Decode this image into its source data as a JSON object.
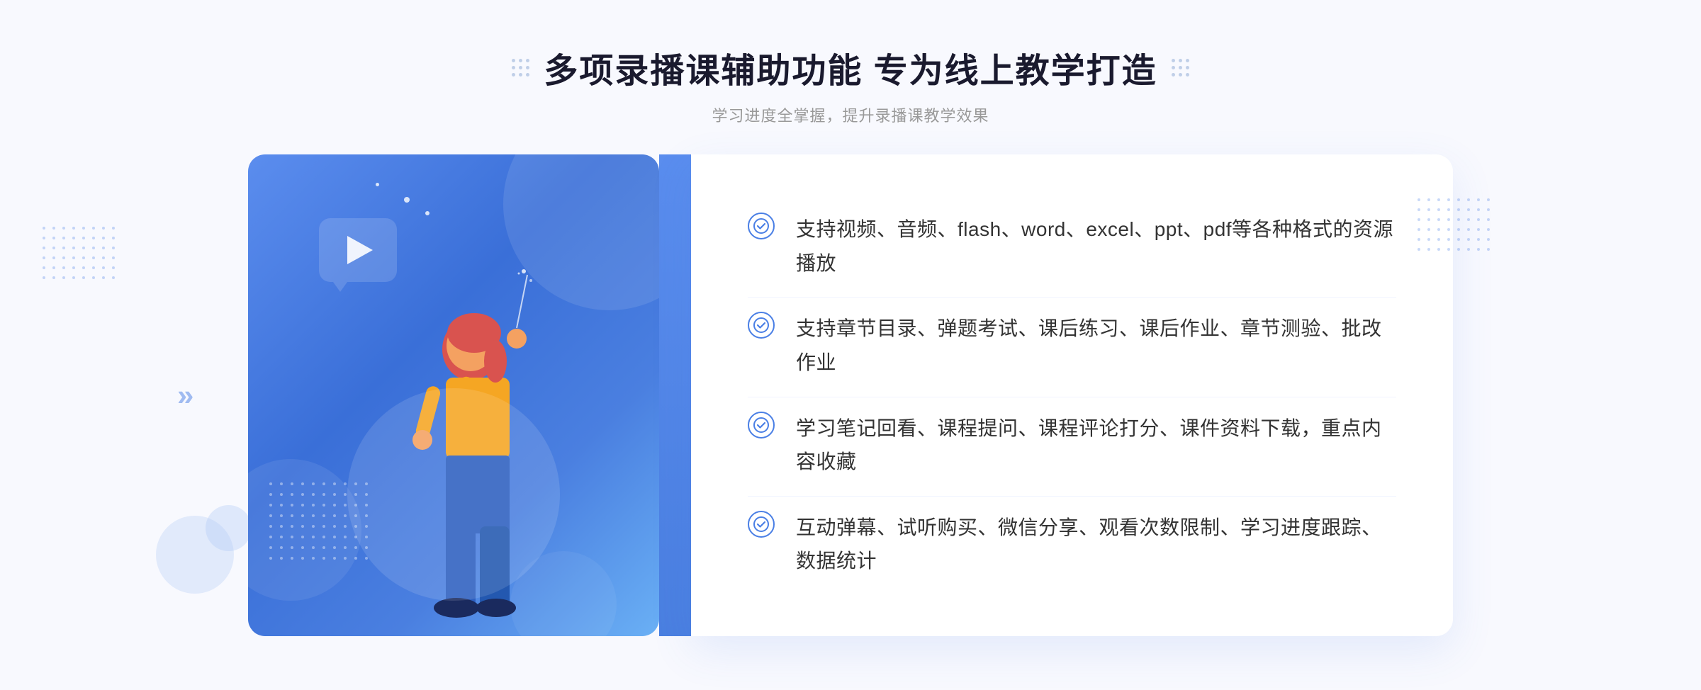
{
  "page": {
    "background_color": "#f8f9fe"
  },
  "header": {
    "title": "多项录播课辅助功能 专为线上教学打造",
    "subtitle": "学习进度全掌握，提升录播课教学效果"
  },
  "features": [
    {
      "id": "feature-1",
      "text": "支持视频、音频、flash、word、excel、ppt、pdf等各种格式的资源播放"
    },
    {
      "id": "feature-2",
      "text": "支持章节目录、弹题考试、课后练习、课后作业、章节测验、批改作业"
    },
    {
      "id": "feature-3",
      "text": "学习笔记回看、课程提问、课程评论打分、课件资料下载，重点内容收藏"
    },
    {
      "id": "feature-4",
      "text": "互动弹幕、试听购买、微信分享、观看次数限制、学习进度跟踪、数据统计"
    }
  ],
  "decoration": {
    "chevron_symbol": "»",
    "play_icon": "▶"
  }
}
